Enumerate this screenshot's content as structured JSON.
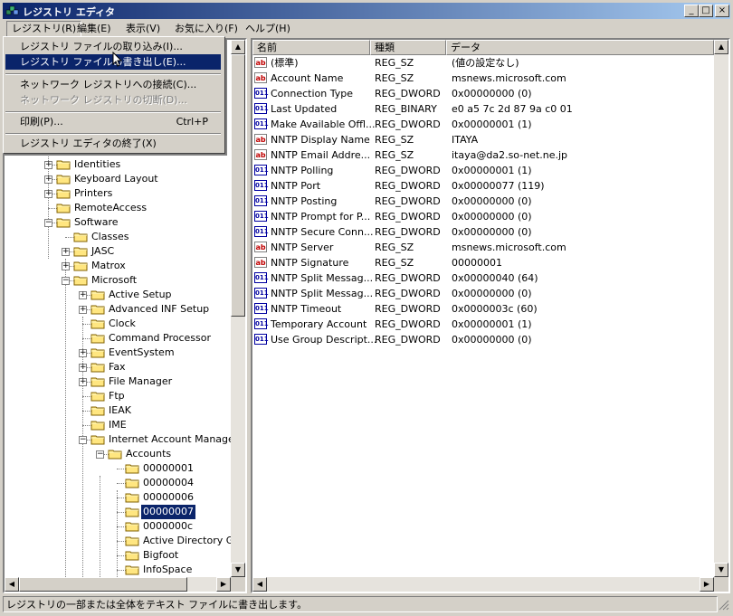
{
  "window": {
    "title": "レジストリ エディタ",
    "min": "_",
    "max": "□",
    "close": "×"
  },
  "menubar": {
    "items": [
      {
        "label": "レジストリ(R)"
      },
      {
        "label": "編集(E)"
      },
      {
        "label": "表示(V)"
      },
      {
        "label": "お気に入り(F)"
      },
      {
        "label": "ヘルプ(H)"
      }
    ]
  },
  "dropdown": {
    "items": [
      {
        "label": "レジストリ ファイルの取り込み(I)..."
      },
      {
        "label": "レジストリ ファイルの書き出し(E)..."
      },
      {
        "label": "ネットワーク レジストリへの接続(C)..."
      },
      {
        "label": "ネットワーク レジストリの切断(D)..."
      },
      {
        "label": "印刷(P)...",
        "shortcut": "Ctrl+P"
      },
      {
        "label": "レジストリ エディタの終了(X)"
      }
    ]
  },
  "tree": {
    "items": [
      {
        "label": "Identities",
        "expander": "+"
      },
      {
        "label": "Keyboard Layout",
        "expander": "+"
      },
      {
        "label": "Printers",
        "expander": "+"
      },
      {
        "label": "RemoteAccess",
        "expander": ""
      },
      {
        "label": "Software",
        "expander": "-"
      },
      {
        "label": "Classes",
        "expander": ""
      },
      {
        "label": "JASC",
        "expander": "+"
      },
      {
        "label": "Matrox",
        "expander": "+"
      },
      {
        "label": "Microsoft",
        "expander": "-"
      },
      {
        "label": "Active Setup",
        "expander": "+"
      },
      {
        "label": "Advanced INF Setup",
        "expander": "+"
      },
      {
        "label": "Clock",
        "expander": ""
      },
      {
        "label": "Command Processor",
        "expander": ""
      },
      {
        "label": "EventSystem",
        "expander": "+"
      },
      {
        "label": "Fax",
        "expander": "+"
      },
      {
        "label": "File Manager",
        "expander": "+"
      },
      {
        "label": "Ftp",
        "expander": ""
      },
      {
        "label": "IEAK",
        "expander": ""
      },
      {
        "label": "IME",
        "expander": ""
      },
      {
        "label": "Internet Account Manager",
        "expander": "-"
      },
      {
        "label": "Accounts",
        "expander": "-"
      },
      {
        "label": "00000001",
        "expander": ""
      },
      {
        "label": "00000004",
        "expander": ""
      },
      {
        "label": "00000006",
        "expander": ""
      },
      {
        "label": "00000007",
        "expander": "",
        "selected": true
      },
      {
        "label": "0000000c",
        "expander": ""
      },
      {
        "label": "Active Directory G",
        "expander": ""
      },
      {
        "label": "Bigfoot",
        "expander": ""
      },
      {
        "label": "InfoSpace",
        "expander": ""
      }
    ]
  },
  "values": {
    "columns": [
      "名前",
      "種類",
      "データ"
    ],
    "rows": [
      {
        "icon": "string",
        "name": "(標準)",
        "type": "REG_SZ",
        "data": "(値の設定なし)"
      },
      {
        "icon": "string",
        "name": "Account Name",
        "type": "REG_SZ",
        "data": "msnews.microsoft.com"
      },
      {
        "icon": "binary",
        "name": "Connection Type",
        "type": "REG_DWORD",
        "data": "0x00000000 (0)"
      },
      {
        "icon": "binary",
        "name": "Last Updated",
        "type": "REG_BINARY",
        "data": "e0 a5 7c 2d 87 9a c0 01"
      },
      {
        "icon": "binary",
        "name": "Make Available Offl...",
        "type": "REG_DWORD",
        "data": "0x00000001 (1)"
      },
      {
        "icon": "string",
        "name": "NNTP Display Name",
        "type": "REG_SZ",
        "data": "ITAYA"
      },
      {
        "icon": "string",
        "name": "NNTP Email Addre...",
        "type": "REG_SZ",
        "data": "itaya@da2.so-net.ne.jp"
      },
      {
        "icon": "binary",
        "name": "NNTP Polling",
        "type": "REG_DWORD",
        "data": "0x00000001 (1)"
      },
      {
        "icon": "binary",
        "name": "NNTP Port",
        "type": "REG_DWORD",
        "data": "0x00000077 (119)"
      },
      {
        "icon": "binary",
        "name": "NNTP Posting",
        "type": "REG_DWORD",
        "data": "0x00000000 (0)"
      },
      {
        "icon": "binary",
        "name": "NNTP Prompt for P...",
        "type": "REG_DWORD",
        "data": "0x00000000 (0)"
      },
      {
        "icon": "binary",
        "name": "NNTP Secure Conn...",
        "type": "REG_DWORD",
        "data": "0x00000000 (0)"
      },
      {
        "icon": "string",
        "name": "NNTP Server",
        "type": "REG_SZ",
        "data": "msnews.microsoft.com"
      },
      {
        "icon": "string",
        "name": "NNTP Signature",
        "type": "REG_SZ",
        "data": "00000001"
      },
      {
        "icon": "binary",
        "name": "NNTP Split Messag...",
        "type": "REG_DWORD",
        "data": "0x00000040 (64)"
      },
      {
        "icon": "binary",
        "name": "NNTP Split Messag...",
        "type": "REG_DWORD",
        "data": "0x00000000 (0)"
      },
      {
        "icon": "binary",
        "name": "NNTP Timeout",
        "type": "REG_DWORD",
        "data": "0x0000003c (60)"
      },
      {
        "icon": "binary",
        "name": "Temporary Account",
        "type": "REG_DWORD",
        "data": "0x00000001 (1)"
      },
      {
        "icon": "binary",
        "name": "Use Group Descript...",
        "type": "REG_DWORD",
        "data": "0x00000000 (0)"
      }
    ]
  },
  "statusbar": {
    "text": "レジストリの一部または全体をテキスト ファイルに書き出します。"
  }
}
